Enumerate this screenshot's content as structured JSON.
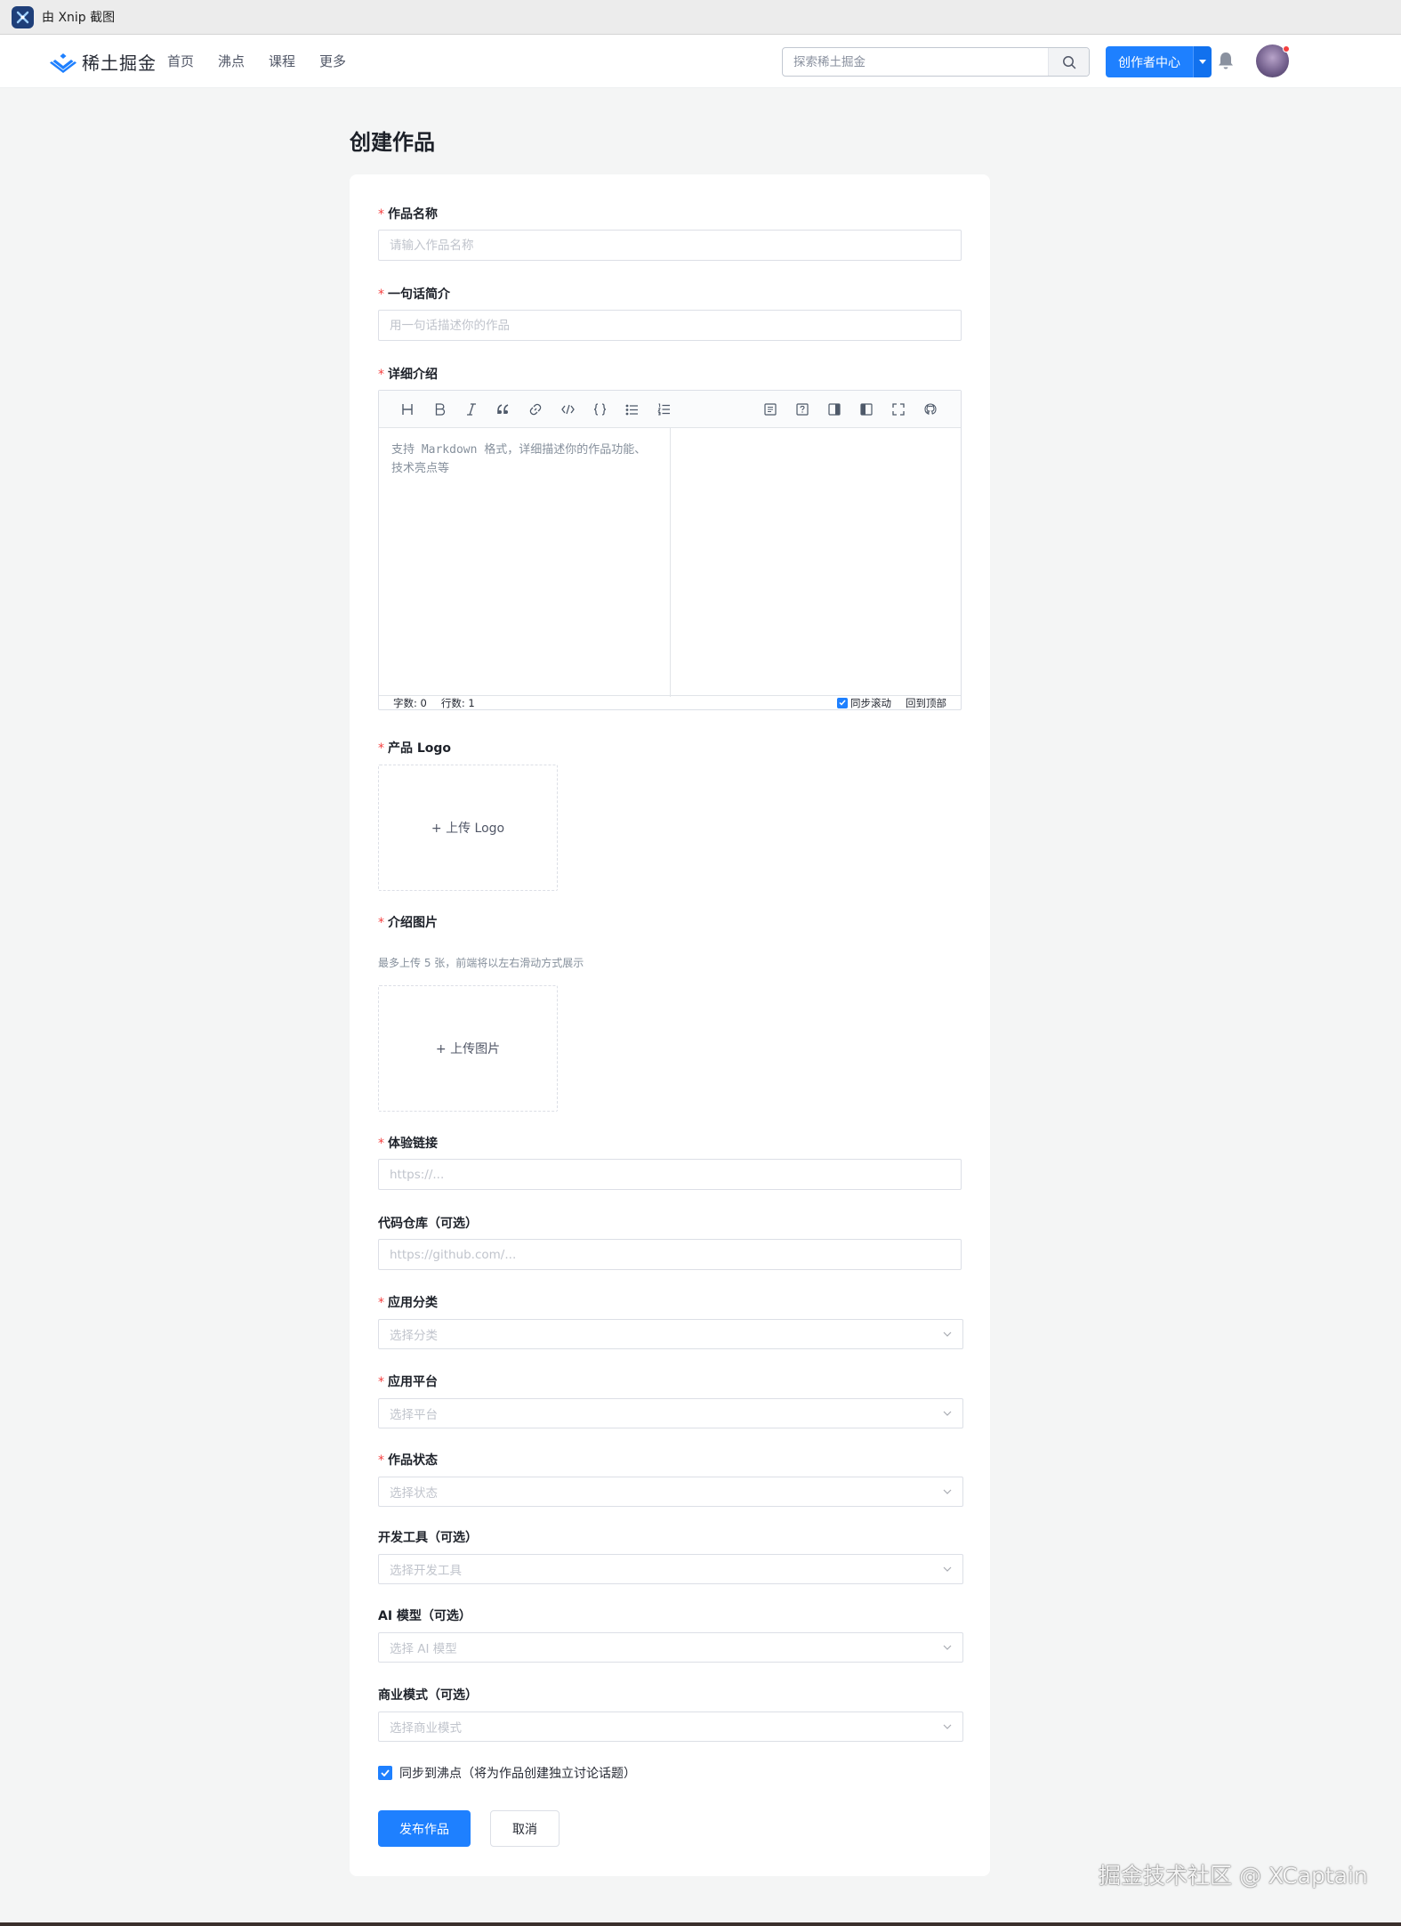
{
  "window": {
    "title": "由 Xnip 截图"
  },
  "header": {
    "logo_text": "稀土掘金",
    "nav": [
      "首页",
      "沸点",
      "课程",
      "更多"
    ],
    "search_placeholder": "探索稀土掘金",
    "creator_button": "创作者中心"
  },
  "page": {
    "title": "创建作品"
  },
  "form": {
    "name": {
      "label": "作品名称",
      "placeholder": "请输入作品名称"
    },
    "summary": {
      "label": "一句话简介",
      "placeholder": "用一句话描述你的作品"
    },
    "detail": {
      "label": "详细介绍",
      "placeholder": "支持 Markdown 格式，详细描述你的作品功能、技术亮点等",
      "status": {
        "chars": "字数: 0",
        "lines": "行数: 1",
        "sync_scroll": "同步滚动",
        "back_top": "回到顶部"
      }
    },
    "logo": {
      "label": "产品 Logo",
      "upload_text": "+ 上传 Logo"
    },
    "images": {
      "label": "介绍图片",
      "hint": "最多上传 5 张，前端将以左右滑动方式展示",
      "upload_text": "+ 上传图片"
    },
    "demo_link": {
      "label": "体验链接",
      "placeholder": "https://..."
    },
    "repo": {
      "label": "代码仓库（可选）",
      "placeholder": "https://github.com/..."
    },
    "category": {
      "label": "应用分类",
      "placeholder": "选择分类"
    },
    "platform": {
      "label": "应用平台",
      "placeholder": "选择平台"
    },
    "status_field": {
      "label": "作品状态",
      "placeholder": "选择状态"
    },
    "dev_tools": {
      "label": "开发工具（可选）",
      "placeholder": "选择开发工具"
    },
    "ai_model": {
      "label": "AI 模型（可选）",
      "placeholder": "选择 AI 模型"
    },
    "business": {
      "label": "商业模式（可选）",
      "placeholder": "选择商业模式"
    },
    "sync": {
      "label": "同步到沸点（将为作品创建独立讨论话题）",
      "checked": true
    },
    "required_mark": "*",
    "submit": "发布作品",
    "cancel": "取消"
  },
  "watermark": "掘金技术社区 @ XCaptain",
  "colors": {
    "primary": "#1e80ff",
    "required": "#f53f3f",
    "background": "#f4f5f5"
  }
}
